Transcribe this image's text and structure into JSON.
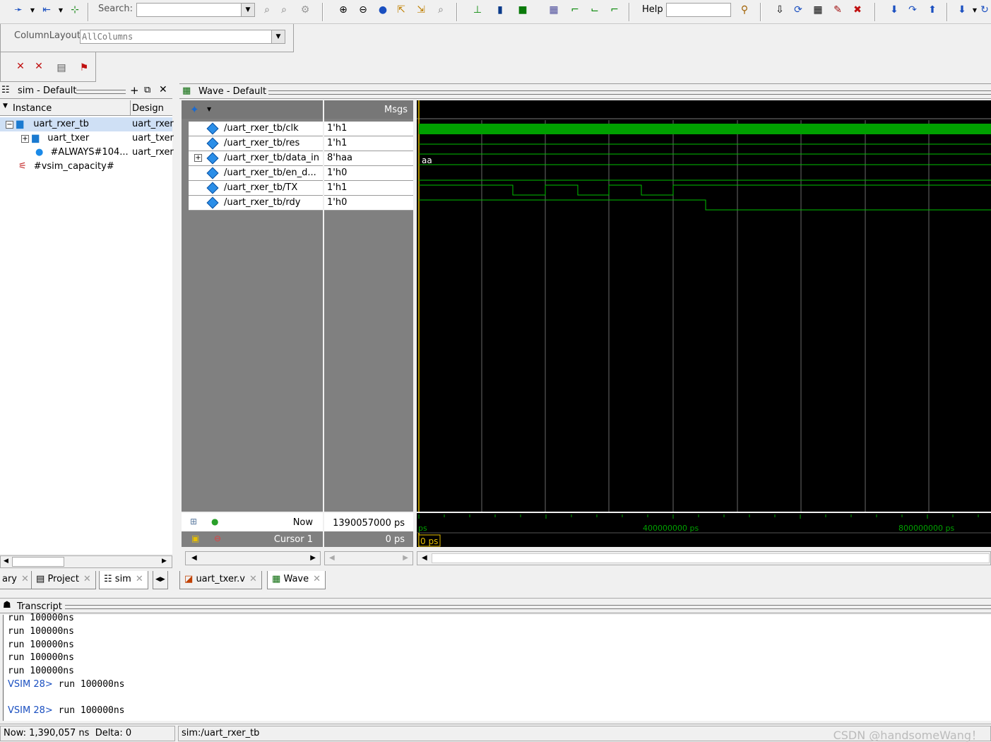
{
  "toolbar": {
    "search_label": "Search:",
    "help_label": "Help",
    "column_layout_label": "ColumnLayout",
    "column_layout_value": "AllColumns"
  },
  "sim_panel": {
    "title": "sim - Default",
    "columns": [
      "Instance",
      "Design ur"
    ],
    "rows": [
      {
        "name": "uart_rxer_tb",
        "design": "uart_rxer",
        "expander": "−"
      },
      {
        "name": "uart_txer",
        "design": "uart_txer",
        "expander": "+"
      },
      {
        "name": "#ALWAYS#104...",
        "design": "uart_rxer",
        "expander": ""
      },
      {
        "name": "#vsim_capacity#",
        "design": "",
        "expander": ""
      }
    ]
  },
  "wave_panel": {
    "title": "Wave - Default",
    "msgs_label": "Msgs",
    "signals": [
      {
        "name": "/uart_rxer_tb/clk",
        "value": "1'h1",
        "expander": ""
      },
      {
        "name": "/uart_rxer_tb/res",
        "value": "1'h1",
        "expander": ""
      },
      {
        "name": "/uart_rxer_tb/data_in",
        "value": "8'haa",
        "expander": "+"
      },
      {
        "name": "/uart_rxer_tb/en_d...",
        "value": "1'h0",
        "expander": ""
      },
      {
        "name": "/uart_rxer_tb/TX",
        "value": "1'h1",
        "expander": ""
      },
      {
        "name": "/uart_rxer_tb/rdy",
        "value": "1'h0",
        "expander": ""
      }
    ],
    "bus_label": "aa",
    "now_label": "Now",
    "now_value": "1390057000 ps",
    "cursor_label": "Cursor 1",
    "cursor_value": "0 ps",
    "cursor_tag": "0 ps",
    "time_labels": [
      "ps",
      "400000000 ps",
      "800000000 ps"
    ]
  },
  "left_tabs": [
    {
      "label": "ary"
    },
    {
      "label": "Project"
    },
    {
      "label": "sim"
    }
  ],
  "main_tabs": [
    {
      "label": "uart_txer.v"
    },
    {
      "label": "Wave"
    }
  ],
  "transcript": {
    "title": "Transcript",
    "lines": [
      {
        "prompt": "",
        "text": "run 100000ns"
      },
      {
        "prompt": "",
        "text": "run 100000ns"
      },
      {
        "prompt": "",
        "text": "run 100000ns"
      },
      {
        "prompt": "",
        "text": "run 100000ns"
      },
      {
        "prompt": "",
        "text": "run 100000ns"
      },
      {
        "prompt": "VSIM 28>",
        "text": " run 100000ns"
      },
      {
        "prompt": "",
        "text": ""
      },
      {
        "prompt": "VSIM 28>",
        "text": " run 100000ns"
      }
    ]
  },
  "status": {
    "now": "Now: 1,390,057 ns",
    "delta": "Delta: 0",
    "context": "sim:/uart_rxer_tb",
    "watermark": "CSDN @handsomeWang！"
  },
  "colors": {
    "wave_bg": "#000000",
    "wave_green": "#00c000",
    "cursor_yellow": "#e8c000",
    "grid": "#6a6a6a"
  }
}
